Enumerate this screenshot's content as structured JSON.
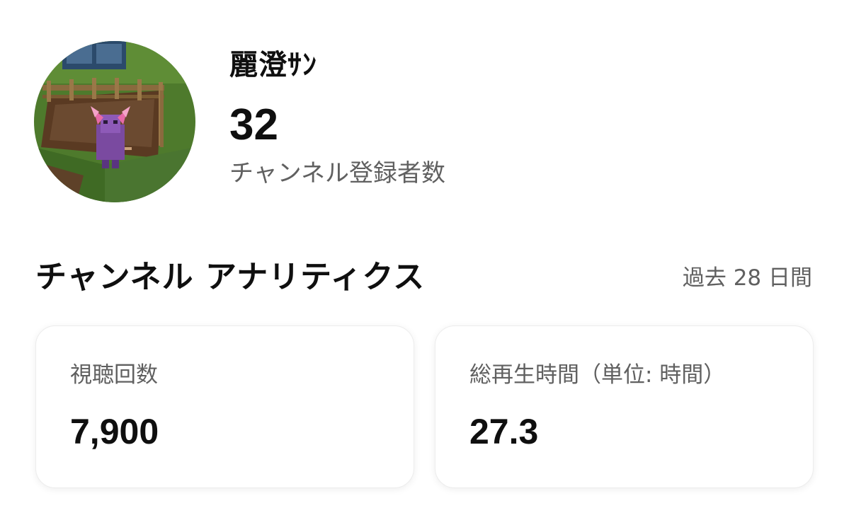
{
  "channel": {
    "name": "麗澄ｻﾝ",
    "subscriber_count": "32",
    "subscriber_label": "チャンネル登録者数",
    "avatar_icon": "minecraft-character-avatar"
  },
  "analytics": {
    "title": "チャンネル アナリティクス",
    "period": "過去 28 日間",
    "cards": [
      {
        "label": "視聴回数",
        "value": "7,900"
      },
      {
        "label": "総再生時間（単位: 時間）",
        "value": "27.3"
      }
    ]
  },
  "colors": {
    "primary_text": "#0f0f0f",
    "secondary_text": "#606060",
    "card_border": "#ececec",
    "background": "#ffffff"
  }
}
